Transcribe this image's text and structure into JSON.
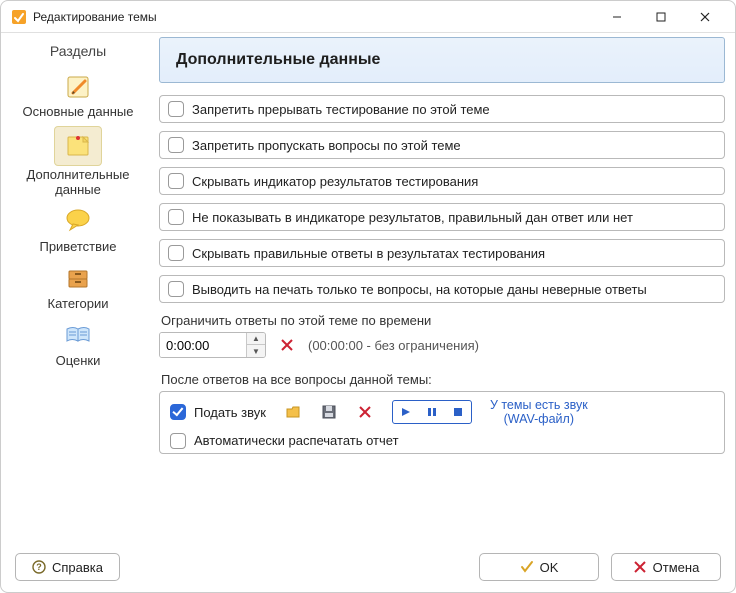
{
  "window": {
    "title": "Редактирование темы"
  },
  "sidebar": {
    "title": "Разделы",
    "items": [
      {
        "label": "Основные данные"
      },
      {
        "label": "Дополнительные\nданные"
      },
      {
        "label": "Приветствие"
      },
      {
        "label": "Категории"
      },
      {
        "label": "Оценки"
      }
    ]
  },
  "main": {
    "header": "Дополнительные данные",
    "options": [
      "Запретить прерывать тестирование по этой теме",
      "Запретить пропускать вопросы по этой теме",
      "Скрывать индикатор результатов тестирования",
      "Не показывать в индикаторе результатов, правильный дан ответ или нет",
      "Скрывать правильные ответы в результатах тестирования",
      "Выводить на печать только те вопросы, на которые даны неверные ответы"
    ],
    "timeLimit": {
      "label": "Ограничить ответы по этой теме по времени",
      "value": "0:00:00",
      "hint": "(00:00:00 - без ограничения)"
    },
    "afterAnswers": {
      "label": "После ответов на все вопросы данной темы:",
      "playSound": "Подать звук",
      "soundStatusLine1": "У темы есть звук",
      "soundStatusLine2": "(WAV-файл)",
      "autoPrint": "Автоматически распечатать отчет"
    }
  },
  "footer": {
    "help": "Справка",
    "ok": "OK",
    "cancel": "Отмена"
  }
}
